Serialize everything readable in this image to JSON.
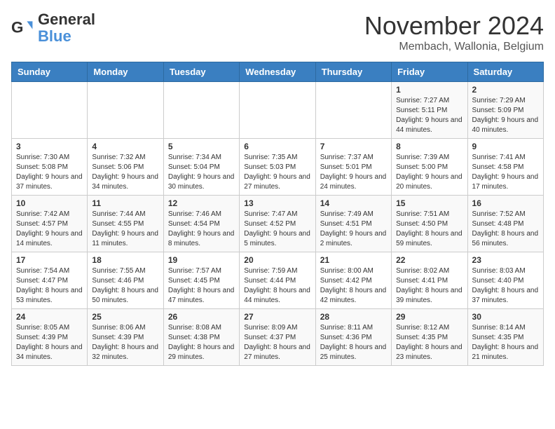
{
  "header": {
    "logo_general": "General",
    "logo_blue": "Blue",
    "month_title": "November 2024",
    "location": "Membach, Wallonia, Belgium"
  },
  "weekdays": [
    "Sunday",
    "Monday",
    "Tuesday",
    "Wednesday",
    "Thursday",
    "Friday",
    "Saturday"
  ],
  "weeks": [
    [
      {
        "day": "",
        "info": ""
      },
      {
        "day": "",
        "info": ""
      },
      {
        "day": "",
        "info": ""
      },
      {
        "day": "",
        "info": ""
      },
      {
        "day": "",
        "info": ""
      },
      {
        "day": "1",
        "info": "Sunrise: 7:27 AM\nSunset: 5:11 PM\nDaylight: 9 hours and 44 minutes."
      },
      {
        "day": "2",
        "info": "Sunrise: 7:29 AM\nSunset: 5:09 PM\nDaylight: 9 hours and 40 minutes."
      }
    ],
    [
      {
        "day": "3",
        "info": "Sunrise: 7:30 AM\nSunset: 5:08 PM\nDaylight: 9 hours and 37 minutes."
      },
      {
        "day": "4",
        "info": "Sunrise: 7:32 AM\nSunset: 5:06 PM\nDaylight: 9 hours and 34 minutes."
      },
      {
        "day": "5",
        "info": "Sunrise: 7:34 AM\nSunset: 5:04 PM\nDaylight: 9 hours and 30 minutes."
      },
      {
        "day": "6",
        "info": "Sunrise: 7:35 AM\nSunset: 5:03 PM\nDaylight: 9 hours and 27 minutes."
      },
      {
        "day": "7",
        "info": "Sunrise: 7:37 AM\nSunset: 5:01 PM\nDaylight: 9 hours and 24 minutes."
      },
      {
        "day": "8",
        "info": "Sunrise: 7:39 AM\nSunset: 5:00 PM\nDaylight: 9 hours and 20 minutes."
      },
      {
        "day": "9",
        "info": "Sunrise: 7:41 AM\nSunset: 4:58 PM\nDaylight: 9 hours and 17 minutes."
      }
    ],
    [
      {
        "day": "10",
        "info": "Sunrise: 7:42 AM\nSunset: 4:57 PM\nDaylight: 9 hours and 14 minutes."
      },
      {
        "day": "11",
        "info": "Sunrise: 7:44 AM\nSunset: 4:55 PM\nDaylight: 9 hours and 11 minutes."
      },
      {
        "day": "12",
        "info": "Sunrise: 7:46 AM\nSunset: 4:54 PM\nDaylight: 9 hours and 8 minutes."
      },
      {
        "day": "13",
        "info": "Sunrise: 7:47 AM\nSunset: 4:52 PM\nDaylight: 9 hours and 5 minutes."
      },
      {
        "day": "14",
        "info": "Sunrise: 7:49 AM\nSunset: 4:51 PM\nDaylight: 9 hours and 2 minutes."
      },
      {
        "day": "15",
        "info": "Sunrise: 7:51 AM\nSunset: 4:50 PM\nDaylight: 8 hours and 59 minutes."
      },
      {
        "day": "16",
        "info": "Sunrise: 7:52 AM\nSunset: 4:48 PM\nDaylight: 8 hours and 56 minutes."
      }
    ],
    [
      {
        "day": "17",
        "info": "Sunrise: 7:54 AM\nSunset: 4:47 PM\nDaylight: 8 hours and 53 minutes."
      },
      {
        "day": "18",
        "info": "Sunrise: 7:55 AM\nSunset: 4:46 PM\nDaylight: 8 hours and 50 minutes."
      },
      {
        "day": "19",
        "info": "Sunrise: 7:57 AM\nSunset: 4:45 PM\nDaylight: 8 hours and 47 minutes."
      },
      {
        "day": "20",
        "info": "Sunrise: 7:59 AM\nSunset: 4:44 PM\nDaylight: 8 hours and 44 minutes."
      },
      {
        "day": "21",
        "info": "Sunrise: 8:00 AM\nSunset: 4:42 PM\nDaylight: 8 hours and 42 minutes."
      },
      {
        "day": "22",
        "info": "Sunrise: 8:02 AM\nSunset: 4:41 PM\nDaylight: 8 hours and 39 minutes."
      },
      {
        "day": "23",
        "info": "Sunrise: 8:03 AM\nSunset: 4:40 PM\nDaylight: 8 hours and 37 minutes."
      }
    ],
    [
      {
        "day": "24",
        "info": "Sunrise: 8:05 AM\nSunset: 4:39 PM\nDaylight: 8 hours and 34 minutes."
      },
      {
        "day": "25",
        "info": "Sunrise: 8:06 AM\nSunset: 4:39 PM\nDaylight: 8 hours and 32 minutes."
      },
      {
        "day": "26",
        "info": "Sunrise: 8:08 AM\nSunset: 4:38 PM\nDaylight: 8 hours and 29 minutes."
      },
      {
        "day": "27",
        "info": "Sunrise: 8:09 AM\nSunset: 4:37 PM\nDaylight: 8 hours and 27 minutes."
      },
      {
        "day": "28",
        "info": "Sunrise: 8:11 AM\nSunset: 4:36 PM\nDaylight: 8 hours and 25 minutes."
      },
      {
        "day": "29",
        "info": "Sunrise: 8:12 AM\nSunset: 4:35 PM\nDaylight: 8 hours and 23 minutes."
      },
      {
        "day": "30",
        "info": "Sunrise: 8:14 AM\nSunset: 4:35 PM\nDaylight: 8 hours and 21 minutes."
      }
    ]
  ]
}
